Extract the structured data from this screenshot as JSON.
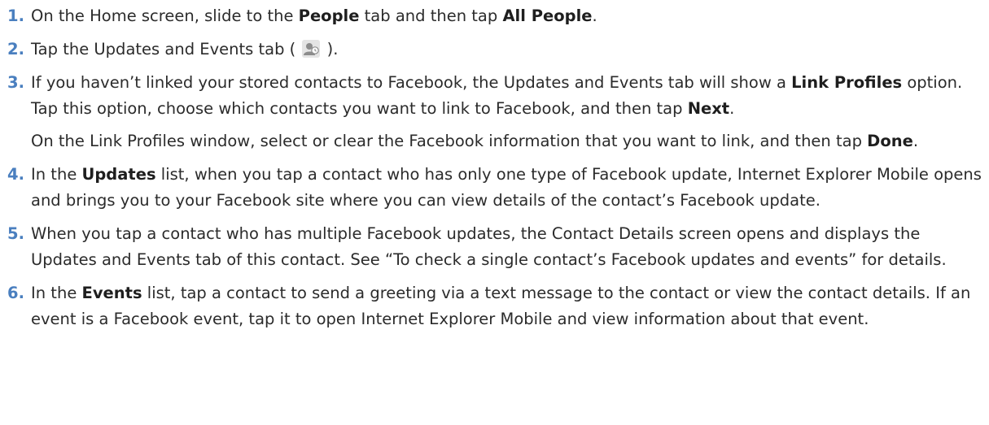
{
  "steps": [
    {
      "num": "1.",
      "segments": [
        {
          "t": "On the Home screen, slide to the "
        },
        {
          "t": "People",
          "b": true
        },
        {
          "t": " tab and then tap "
        },
        {
          "t": "All People",
          "b": true
        },
        {
          "t": "."
        }
      ]
    },
    {
      "num": "2.",
      "segments": [
        {
          "t": "Tap the Updates and Events tab ( "
        },
        {
          "icon": "updates-events-tab-icon"
        },
        {
          "t": " )."
        }
      ]
    },
    {
      "num": "3.",
      "segments": [
        {
          "t": "If you haven’t linked your stored contacts to Facebook, the Updates and Events tab will show a "
        },
        {
          "t": "Link Profiles",
          "b": true
        },
        {
          "t": " option. Tap this option, choose which contacts you want to link to Facebook, and then tap "
        },
        {
          "t": "Next",
          "b": true
        },
        {
          "t": "."
        }
      ],
      "extra": [
        {
          "t": "On the Link Profiles window, select or clear the Facebook information that you want to link, and then tap "
        },
        {
          "t": "Done",
          "b": true
        },
        {
          "t": "."
        }
      ]
    },
    {
      "num": "4.",
      "segments": [
        {
          "t": "In the "
        },
        {
          "t": "Updates",
          "b": true
        },
        {
          "t": " list, when you tap a contact who has only one type of Facebook update, Internet Explorer Mobile opens and brings you to your Facebook site where you can view details of the contact’s Facebook update."
        }
      ]
    },
    {
      "num": "5.",
      "segments": [
        {
          "t": "When you tap a contact who has multiple Facebook updates, the Contact Details screen opens and displays the Updates and Events tab of this contact. See “To check a single contact’s Facebook updates and events” for details."
        }
      ]
    },
    {
      "num": "6.",
      "segments": [
        {
          "t": "In the "
        },
        {
          "t": "Events",
          "b": true
        },
        {
          "t": " list, tap a contact to send a greeting via a text message to the contact or view the contact details. If an event is a Facebook event, tap it to open Internet Explorer Mobile and view information about that event."
        }
      ]
    }
  ],
  "colors": {
    "step_number": "#4a7fbf",
    "text": "#2b2b2b",
    "icon_bg": "#e4e4e4"
  }
}
